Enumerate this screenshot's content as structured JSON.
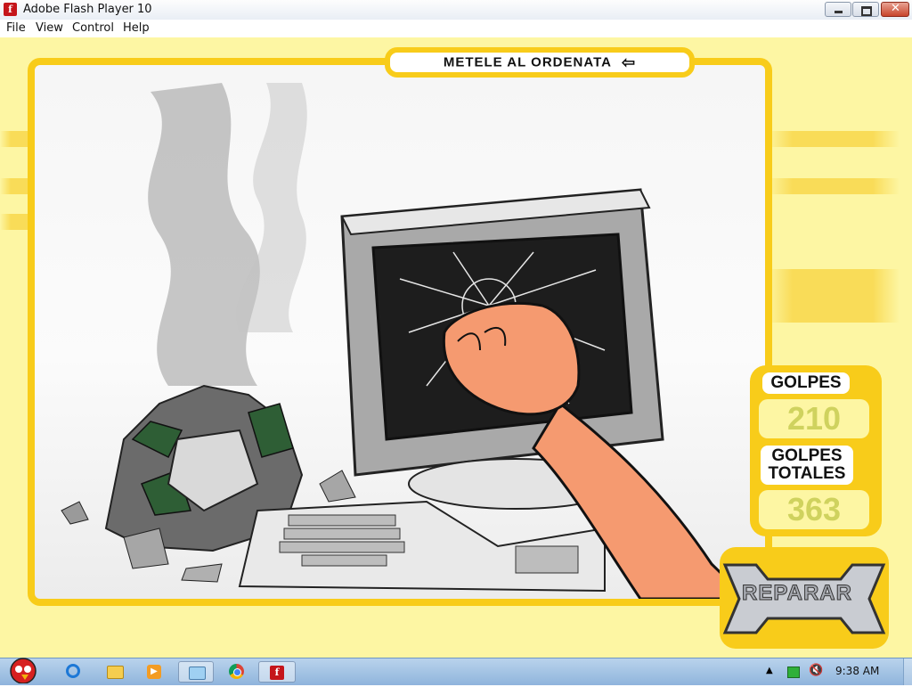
{
  "window": {
    "title": "Adobe Flash Player 10",
    "controls": [
      "minimize",
      "restore",
      "close"
    ]
  },
  "menu": {
    "items": [
      "File",
      "View",
      "Control",
      "Help"
    ]
  },
  "game": {
    "title": "METELE AL ORDENATA",
    "back_icon": "back-arrow-icon",
    "counters": {
      "hits_label": "GOLPES",
      "hits_value": "210",
      "total_label_line1": "GOLPES",
      "total_label_line2": "TOTALES",
      "total_value": "363"
    },
    "repair_button": "REPARAR"
  },
  "taskbar": {
    "icons": [
      "angry-birds-start-icon",
      "internet-explorer-icon",
      "folder-icon",
      "media-player-icon",
      "windows-explorer-icon",
      "chrome-icon",
      "flash-player-icon"
    ],
    "tray_icons": [
      "show-hidden-icons-icon",
      "battery-icon",
      "volume-muted-icon"
    ],
    "clock": "9:38 AM"
  },
  "colors": {
    "stage_bg": "#fdf6a3",
    "frame_yellow": "#f8cc1a",
    "counter_value": "#cfd25e"
  }
}
